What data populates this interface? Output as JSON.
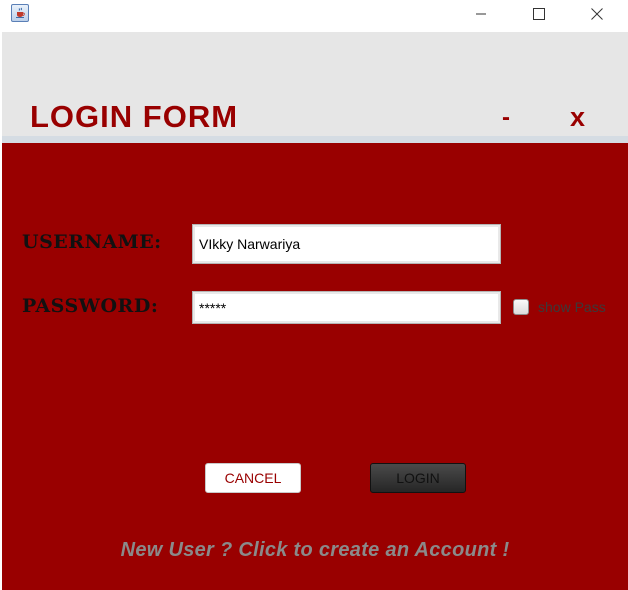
{
  "os_titlebar": {
    "icon": "java-cup-icon",
    "minimize_icon": "minimize-icon",
    "maximize_icon": "maximize-icon",
    "close_icon": "close-icon"
  },
  "header": {
    "title": "LOGIN FORM",
    "minimize_label": "-",
    "close_label": "x"
  },
  "form": {
    "username_label": "USERNAME:",
    "username_value": "VIkky Narwariya",
    "password_label": "PASSWORD:",
    "password_value": "*****",
    "show_pass_label": "show Pass",
    "show_pass_checked": false,
    "cancel_label": "CANCEL",
    "login_label": "LOGIN",
    "new_user_link": "New User ? Click to create an Account !"
  },
  "colors": {
    "brand": "#990000",
    "header_bg": "#e6e6e6",
    "link": "#8a8a8a"
  }
}
